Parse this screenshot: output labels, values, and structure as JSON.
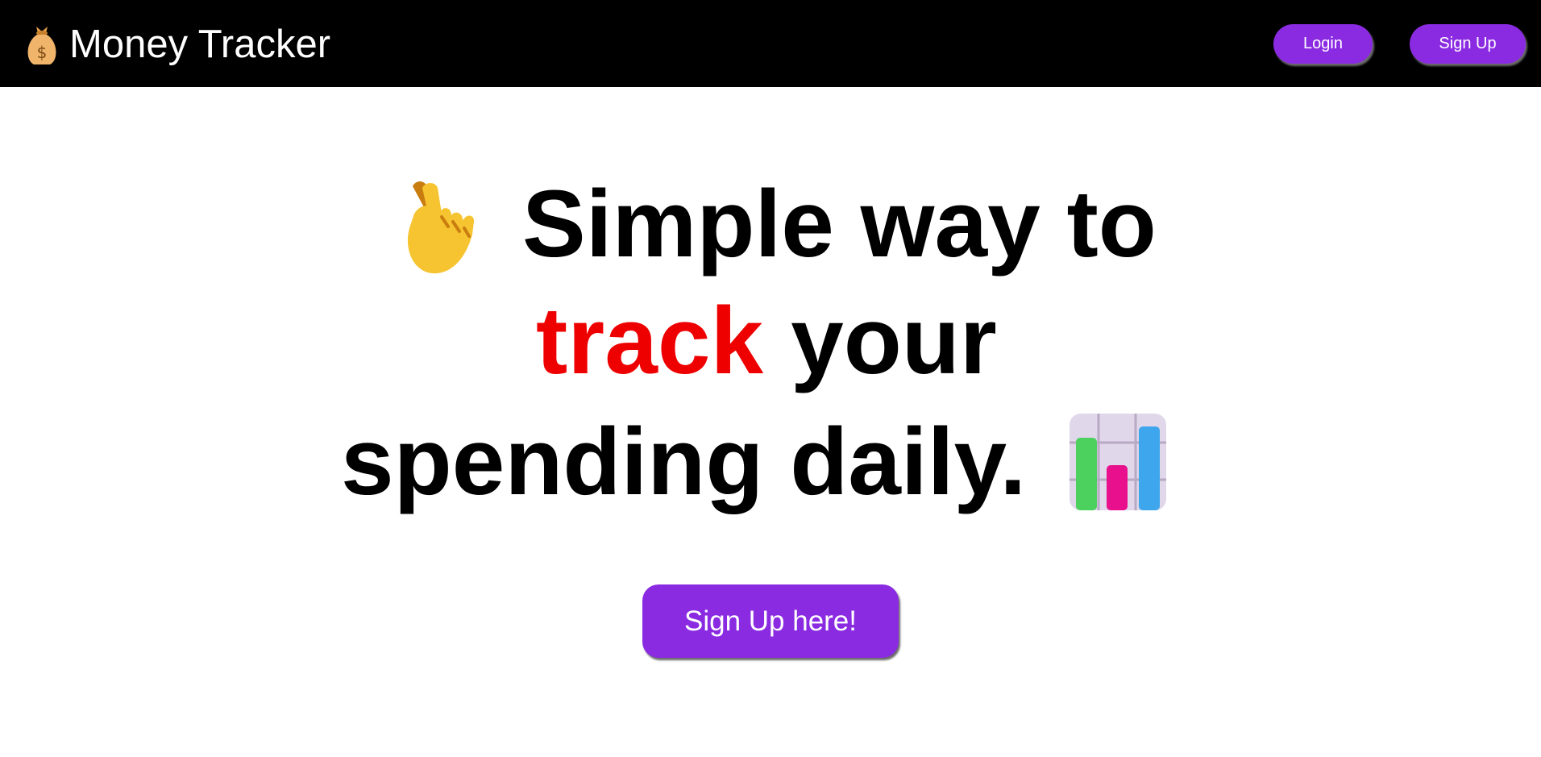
{
  "header": {
    "brand_icon": "money-bag-icon",
    "brand_title": "Money Tracker",
    "login_label": "Login",
    "signup_label": "Sign Up"
  },
  "hero": {
    "line1_icon": "crossed-fingers-hand-icon",
    "line1_text": "Simple way to",
    "line2_accent": "track",
    "line2_text": "your",
    "line3_text": "spending daily.",
    "line3_icon": "bar-chart-icon"
  },
  "cta": {
    "label": "Sign Up here!"
  },
  "colors": {
    "nav_background": "#000000",
    "button_purple": "#8a2be2",
    "accent_red": "#ee0000",
    "text_black": "#000000"
  }
}
